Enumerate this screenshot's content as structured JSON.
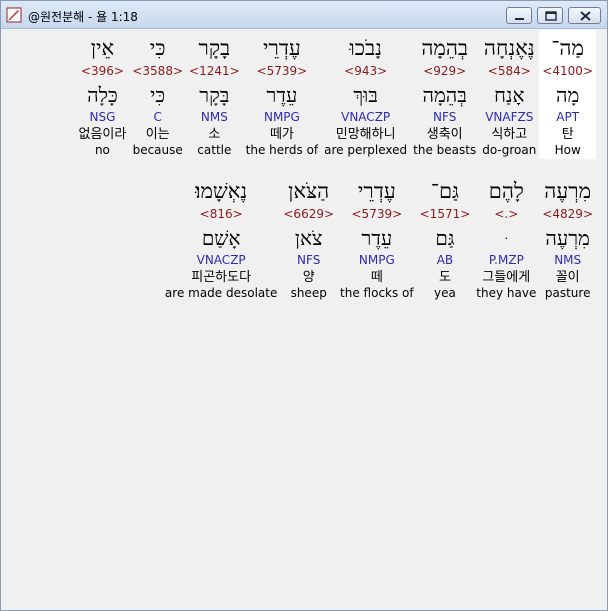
{
  "window": {
    "title": "@원전분해 - 욜 1:18"
  },
  "rows": [
    {
      "words": [
        {
          "hebrew": "מַה־",
          "strong": "<4100>",
          "lemma": "מָה",
          "morph": "APT",
          "korean": "탄",
          "english": "How",
          "selected": true
        },
        {
          "hebrew": "נֶּאֶנְחָה",
          "strong": "<584>",
          "lemma": "אָנַח",
          "morph": "VNAFZS",
          "korean": "식하고",
          "english": "do-groan",
          "selected": false
        },
        {
          "hebrew": "בְהֵמָה",
          "strong": "<929>",
          "lemma": "בְּהֵמָה",
          "morph": "NFS",
          "korean": "생축이",
          "english": "the beasts",
          "selected": false
        },
        {
          "hebrew": "נָבֹכוּ",
          "strong": "<943>",
          "lemma": "בּוּךְ",
          "morph": "VNACZP",
          "korean": "민망해하니",
          "english": "are perplexed",
          "selected": false
        },
        {
          "hebrew": "עֶדְרֵי",
          "strong": "<5739>",
          "lemma": "עֵדֶר",
          "morph": "NMPG",
          "korean": "떼가",
          "english": "the herds of",
          "selected": false
        },
        {
          "hebrew": "בָקָר",
          "strong": "<1241>",
          "lemma": "בָּקָר",
          "morph": "NMS",
          "korean": "소",
          "english": "cattle",
          "selected": false
        },
        {
          "hebrew": "כִּי",
          "strong": "<3588>",
          "lemma": "כִּי",
          "morph": "C",
          "korean": "이는",
          "english": "because",
          "selected": false
        },
        {
          "hebrew": "אֵין",
          "strong": "<396>",
          "lemma": "כָּלָה",
          "morph": "NSG",
          "korean": "없음이라",
          "english": "no",
          "selected": false
        }
      ]
    },
    {
      "words": [
        {
          "hebrew": "מִרְעֶה",
          "strong": "<4829>",
          "lemma": "מִרְעֶה",
          "morph": "NMS",
          "korean": "꼴이",
          "english": "pasture",
          "selected": false
        },
        {
          "hebrew": "לָהֶם",
          "strong": "<.>",
          "lemma": "ּ",
          "morph": "P.MZP",
          "korean": "그들에게",
          "english": "they have",
          "selected": false
        },
        {
          "hebrew": "גַּם־",
          "strong": "<1571>",
          "lemma": "גַּם",
          "morph": "AB",
          "korean": "도",
          "english": "yea",
          "selected": false
        },
        {
          "hebrew": "עֶדְרֵי",
          "strong": "<5739>",
          "lemma": "עֵדֶר",
          "morph": "NMPG",
          "korean": "떼",
          "english": "the flocks of",
          "selected": false
        },
        {
          "hebrew": "הַצֹּאן",
          "strong": "<6629>",
          "lemma": "צֹאן",
          "morph": "NFS",
          "korean": "양",
          "english": "sheep",
          "selected": false
        },
        {
          "hebrew": "נֶאְשָׁמוּ׃",
          "strong": "<816>",
          "lemma": "אָשַׁם",
          "morph": "VNACZP",
          "korean": "피곤하도다",
          "english": "are made desolate",
          "selected": false
        }
      ]
    }
  ]
}
